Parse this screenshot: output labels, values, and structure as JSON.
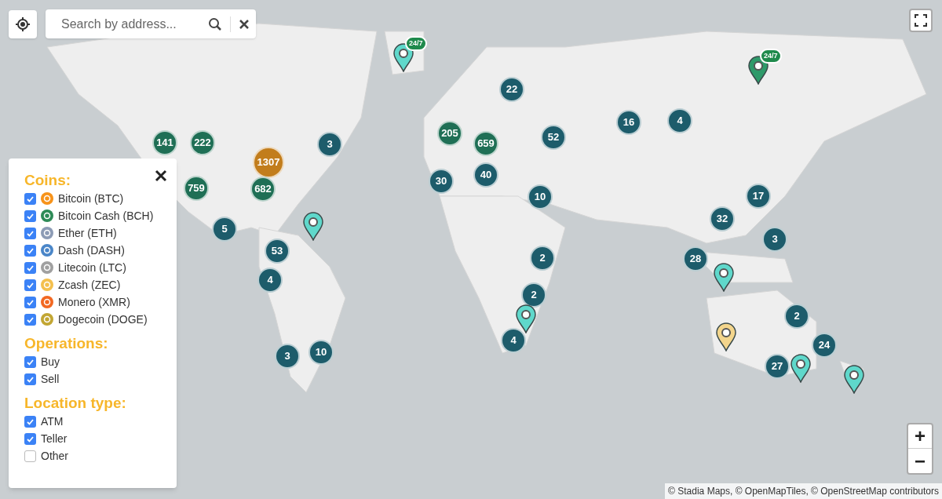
{
  "search": {
    "placeholder": "Search by address..."
  },
  "filters": {
    "sections": [
      {
        "title": "Coins:",
        "items": [
          {
            "label": "Bitcoin (BTC)",
            "checked": true,
            "color": "#f7931a"
          },
          {
            "label": "Bitcoin Cash (BCH)",
            "checked": true,
            "color": "#2e8b57"
          },
          {
            "label": "Ether (ETH)",
            "checked": true,
            "color": "#8c9bb5"
          },
          {
            "label": "Dash (DASH)",
            "checked": true,
            "color": "#4a86c8"
          },
          {
            "label": "Litecoin (LTC)",
            "checked": true,
            "color": "#a0a0a0"
          },
          {
            "label": "Zcash (ZEC)",
            "checked": true,
            "color": "#f4c04e"
          },
          {
            "label": "Monero (XMR)",
            "checked": true,
            "color": "#f26822"
          },
          {
            "label": "Dogecoin (DOGE)",
            "checked": true,
            "color": "#c2a633"
          }
        ]
      },
      {
        "title": "Operations:",
        "items": [
          {
            "label": "Buy",
            "checked": true
          },
          {
            "label": "Sell",
            "checked": true
          }
        ]
      },
      {
        "title": "Location type:",
        "items": [
          {
            "label": "ATM",
            "checked": true
          },
          {
            "label": "Teller",
            "checked": true
          },
          {
            "label": "Other",
            "checked": false
          }
        ]
      }
    ]
  },
  "clusters": [
    {
      "count": "141",
      "color": "#1f6f55"
    },
    {
      "count": "222",
      "color": "#1f6f55"
    },
    {
      "count": "1307",
      "color": "#c27d1c"
    },
    {
      "count": "759",
      "color": "#1f6f55"
    },
    {
      "count": "682",
      "color": "#1f6f55"
    },
    {
      "count": "3",
      "color": "#1d5c6b"
    },
    {
      "count": "5",
      "color": "#1d5c6b"
    },
    {
      "count": "53",
      "color": "#1d5c6b"
    },
    {
      "count": "4",
      "color": "#1d5c6b"
    },
    {
      "count": "3",
      "color": "#1d5c6b"
    },
    {
      "count": "10",
      "color": "#1d5c6b"
    },
    {
      "count": "22",
      "color": "#1d5c6b"
    },
    {
      "count": "205",
      "color": "#1f6f55"
    },
    {
      "count": "659",
      "color": "#1f6f55"
    },
    {
      "count": "52",
      "color": "#1d5c6b"
    },
    {
      "count": "16",
      "color": "#1d5c6b"
    },
    {
      "count": "4",
      "color": "#1d5c6b"
    },
    {
      "count": "30",
      "color": "#1d5c6b"
    },
    {
      "count": "40",
      "color": "#1d5c6b"
    },
    {
      "count": "10",
      "color": "#1d5c6b"
    },
    {
      "count": "17",
      "color": "#1d5c6b"
    },
    {
      "count": "32",
      "color": "#1d5c6b"
    },
    {
      "count": "3",
      "color": "#1d5c6b"
    },
    {
      "count": "28",
      "color": "#1d5c6b"
    },
    {
      "count": "2",
      "color": "#1d5c6b"
    },
    {
      "count": "2",
      "color": "#1d5c6b"
    },
    {
      "count": "4",
      "color": "#1d5c6b"
    },
    {
      "count": "2",
      "color": "#1d5c6b"
    },
    {
      "count": "24",
      "color": "#1d5c6b"
    },
    {
      "count": "27",
      "color": "#1d5c6b"
    }
  ],
  "pins": [
    {
      "color": "#5fd8cb",
      "badge": "24/7"
    },
    {
      "color": "#2e9a6a",
      "badge": "24/7"
    },
    {
      "color": "#5fd8cb"
    },
    {
      "color": "#5fd8cb"
    },
    {
      "color": "#5fd8cb"
    },
    {
      "color": "#f3d58c"
    },
    {
      "color": "#5fd8cb"
    },
    {
      "color": "#5fd8cb"
    }
  ],
  "attribution": "© Stadia Maps, © OpenMapTiles, © OpenStreetMap contributors",
  "zoom": {
    "in": "+",
    "out": "−"
  }
}
